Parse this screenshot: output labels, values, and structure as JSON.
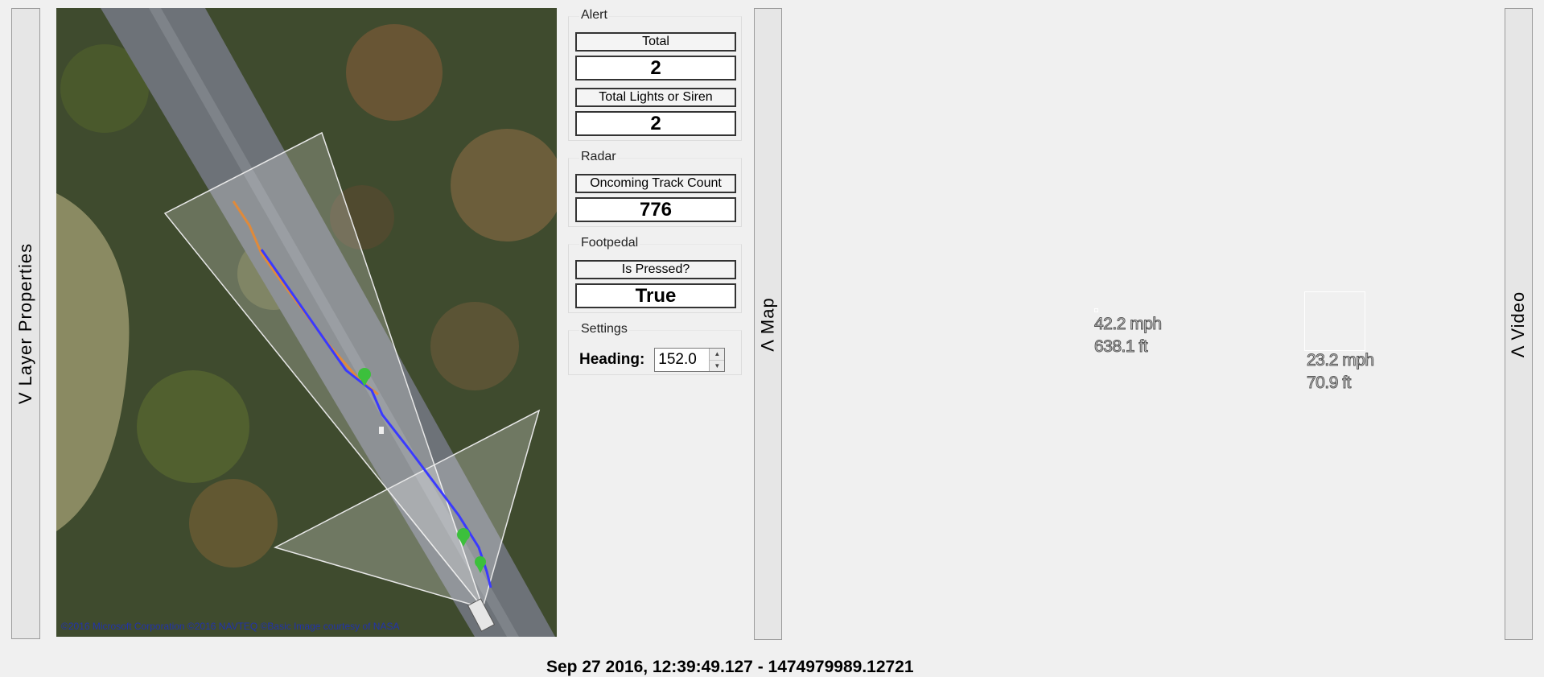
{
  "tabs": {
    "layer_properties": "V  Layer Properties",
    "map": "Λ  Map",
    "video": "Λ  Video"
  },
  "map": {
    "copyright": "©2016 Microsoft Corporation ©2016 NAVTEQ ©Basic Image courtesy of NASA"
  },
  "alert": {
    "title": "Alert",
    "total_label": "Total",
    "total_value": "2",
    "lights_label": "Total Lights or Siren",
    "lights_value": "2"
  },
  "radar": {
    "title": "Radar",
    "oncoming_label": "Oncoming Track Count",
    "oncoming_value": "776"
  },
  "footpedal": {
    "title": "Footpedal",
    "pressed_label": "Is Pressed?",
    "pressed_value": "True"
  },
  "settings": {
    "title": "Settings",
    "heading_label": "Heading:",
    "heading_value": "152.0"
  },
  "tracks": [
    {
      "speed": "42.2 mph",
      "distance": "638.1 ft"
    },
    {
      "speed": "23.2 mph",
      "distance": "70.9 ft"
    }
  ],
  "timestamp": "Sep 27 2016, 12:39:49.127 - 1474979989.12721"
}
